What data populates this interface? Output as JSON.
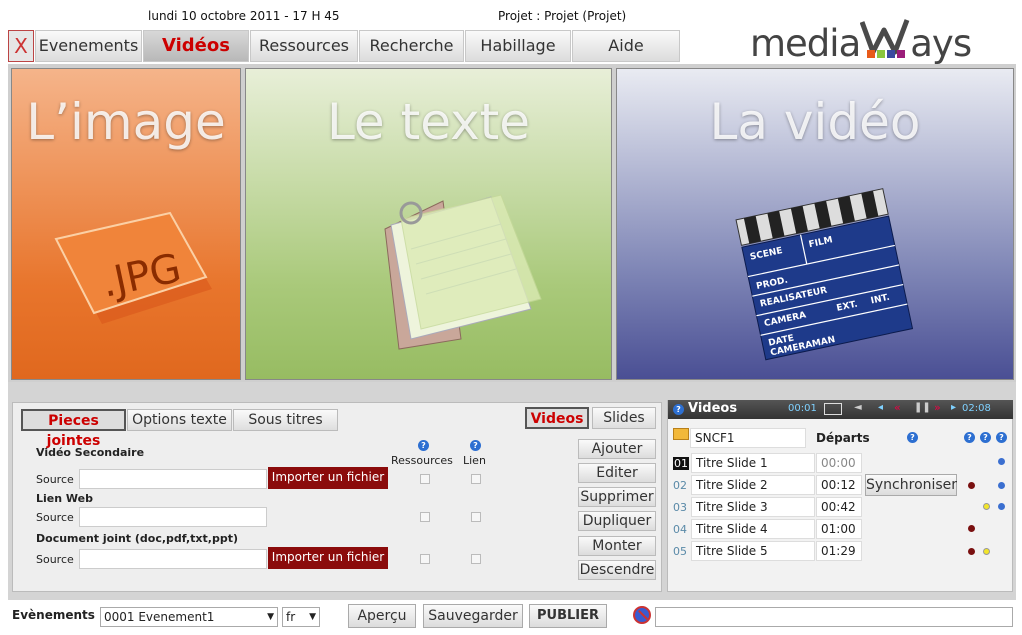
{
  "header": {
    "date": "lundi 10 octobre 2011 - 17 H 45",
    "project": "Projet : Projet (Projet)",
    "close_label": "X"
  },
  "logo": {
    "part1": "media",
    "part2": "ays"
  },
  "tabs": [
    "Evenements",
    "Vidéos",
    "Ressources",
    "Recherche",
    "Habillage",
    "Aide"
  ],
  "panels": {
    "image_title": "L’image",
    "image_badge": ".JPG",
    "text_title": "Le texte",
    "video_title": "La vidéo",
    "clapper": {
      "scene": "SCENE",
      "film": "FILM",
      "prod": "PROD.",
      "real": "REALISATEUR",
      "camera": "CAMERA",
      "ext": "EXT.",
      "int": "INT.",
      "date": "DATE",
      "cameraman": "CAMERAMAN"
    }
  },
  "left": {
    "subtabs": [
      "Pieces jointes",
      "Options texte",
      "Sous titres"
    ],
    "subtabs_right": [
      "Videos",
      "Slides"
    ],
    "video_secondaire": "Vidéo Secondaire",
    "col_ressources": "Ressources",
    "col_lien": "Lien",
    "source": "Source",
    "import_label": "Importer un fichier",
    "lien_web": "Lien Web",
    "doc_joint": "Document joint (doc,pdf,txt,ppt)",
    "actions": [
      "Ajouter",
      "Editer",
      "Supprimer",
      "Dupliquer",
      "Monter",
      "Descendre"
    ]
  },
  "videos": {
    "title": "Videos",
    "time_start": "00:01",
    "time_end": "02:08",
    "folder": "SNCF1",
    "departs": "Départs",
    "sync_label": "Synchroniser",
    "rows": [
      {
        "num": "01",
        "title": "Titre Slide 1",
        "time": "00:00"
      },
      {
        "num": "02",
        "title": "Titre Slide 2",
        "time": "00:12"
      },
      {
        "num": "03",
        "title": "Titre Slide 3",
        "time": "00:42"
      },
      {
        "num": "04",
        "title": "Titre Slide 4",
        "time": "01:00"
      },
      {
        "num": "05",
        "title": "Titre Slide 5",
        "time": "01:29"
      }
    ]
  },
  "bottom": {
    "evenements_label": "Evènements",
    "evenement_value": "0001 Evenement1",
    "lang_value": "fr",
    "apercu": "Aperçu",
    "sauvegarder": "Sauvegarder",
    "publier": "PUBLIER"
  }
}
